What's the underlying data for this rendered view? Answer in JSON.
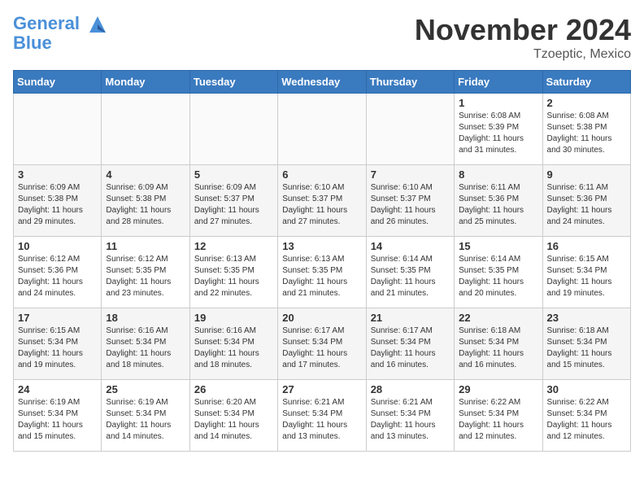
{
  "logo": {
    "line1": "General",
    "line2": "Blue"
  },
  "title": "November 2024",
  "location": "Tzoeptic, Mexico",
  "days_of_week": [
    "Sunday",
    "Monday",
    "Tuesday",
    "Wednesday",
    "Thursday",
    "Friday",
    "Saturday"
  ],
  "weeks": [
    [
      {
        "day": "",
        "info": ""
      },
      {
        "day": "",
        "info": ""
      },
      {
        "day": "",
        "info": ""
      },
      {
        "day": "",
        "info": ""
      },
      {
        "day": "",
        "info": ""
      },
      {
        "day": "1",
        "info": "Sunrise: 6:08 AM\nSunset: 5:39 PM\nDaylight: 11 hours and 31 minutes."
      },
      {
        "day": "2",
        "info": "Sunrise: 6:08 AM\nSunset: 5:38 PM\nDaylight: 11 hours and 30 minutes."
      }
    ],
    [
      {
        "day": "3",
        "info": "Sunrise: 6:09 AM\nSunset: 5:38 PM\nDaylight: 11 hours and 29 minutes."
      },
      {
        "day": "4",
        "info": "Sunrise: 6:09 AM\nSunset: 5:38 PM\nDaylight: 11 hours and 28 minutes."
      },
      {
        "day": "5",
        "info": "Sunrise: 6:09 AM\nSunset: 5:37 PM\nDaylight: 11 hours and 27 minutes."
      },
      {
        "day": "6",
        "info": "Sunrise: 6:10 AM\nSunset: 5:37 PM\nDaylight: 11 hours and 27 minutes."
      },
      {
        "day": "7",
        "info": "Sunrise: 6:10 AM\nSunset: 5:37 PM\nDaylight: 11 hours and 26 minutes."
      },
      {
        "day": "8",
        "info": "Sunrise: 6:11 AM\nSunset: 5:36 PM\nDaylight: 11 hours and 25 minutes."
      },
      {
        "day": "9",
        "info": "Sunrise: 6:11 AM\nSunset: 5:36 PM\nDaylight: 11 hours and 24 minutes."
      }
    ],
    [
      {
        "day": "10",
        "info": "Sunrise: 6:12 AM\nSunset: 5:36 PM\nDaylight: 11 hours and 24 minutes."
      },
      {
        "day": "11",
        "info": "Sunrise: 6:12 AM\nSunset: 5:35 PM\nDaylight: 11 hours and 23 minutes."
      },
      {
        "day": "12",
        "info": "Sunrise: 6:13 AM\nSunset: 5:35 PM\nDaylight: 11 hours and 22 minutes."
      },
      {
        "day": "13",
        "info": "Sunrise: 6:13 AM\nSunset: 5:35 PM\nDaylight: 11 hours and 21 minutes."
      },
      {
        "day": "14",
        "info": "Sunrise: 6:14 AM\nSunset: 5:35 PM\nDaylight: 11 hours and 21 minutes."
      },
      {
        "day": "15",
        "info": "Sunrise: 6:14 AM\nSunset: 5:35 PM\nDaylight: 11 hours and 20 minutes."
      },
      {
        "day": "16",
        "info": "Sunrise: 6:15 AM\nSunset: 5:34 PM\nDaylight: 11 hours and 19 minutes."
      }
    ],
    [
      {
        "day": "17",
        "info": "Sunrise: 6:15 AM\nSunset: 5:34 PM\nDaylight: 11 hours and 19 minutes."
      },
      {
        "day": "18",
        "info": "Sunrise: 6:16 AM\nSunset: 5:34 PM\nDaylight: 11 hours and 18 minutes."
      },
      {
        "day": "19",
        "info": "Sunrise: 6:16 AM\nSunset: 5:34 PM\nDaylight: 11 hours and 18 minutes."
      },
      {
        "day": "20",
        "info": "Sunrise: 6:17 AM\nSunset: 5:34 PM\nDaylight: 11 hours and 17 minutes."
      },
      {
        "day": "21",
        "info": "Sunrise: 6:17 AM\nSunset: 5:34 PM\nDaylight: 11 hours and 16 minutes."
      },
      {
        "day": "22",
        "info": "Sunrise: 6:18 AM\nSunset: 5:34 PM\nDaylight: 11 hours and 16 minutes."
      },
      {
        "day": "23",
        "info": "Sunrise: 6:18 AM\nSunset: 5:34 PM\nDaylight: 11 hours and 15 minutes."
      }
    ],
    [
      {
        "day": "24",
        "info": "Sunrise: 6:19 AM\nSunset: 5:34 PM\nDaylight: 11 hours and 15 minutes."
      },
      {
        "day": "25",
        "info": "Sunrise: 6:19 AM\nSunset: 5:34 PM\nDaylight: 11 hours and 14 minutes."
      },
      {
        "day": "26",
        "info": "Sunrise: 6:20 AM\nSunset: 5:34 PM\nDaylight: 11 hours and 14 minutes."
      },
      {
        "day": "27",
        "info": "Sunrise: 6:21 AM\nSunset: 5:34 PM\nDaylight: 11 hours and 13 minutes."
      },
      {
        "day": "28",
        "info": "Sunrise: 6:21 AM\nSunset: 5:34 PM\nDaylight: 11 hours and 13 minutes."
      },
      {
        "day": "29",
        "info": "Sunrise: 6:22 AM\nSunset: 5:34 PM\nDaylight: 11 hours and 12 minutes."
      },
      {
        "day": "30",
        "info": "Sunrise: 6:22 AM\nSunset: 5:34 PM\nDaylight: 11 hours and 12 minutes."
      }
    ]
  ]
}
